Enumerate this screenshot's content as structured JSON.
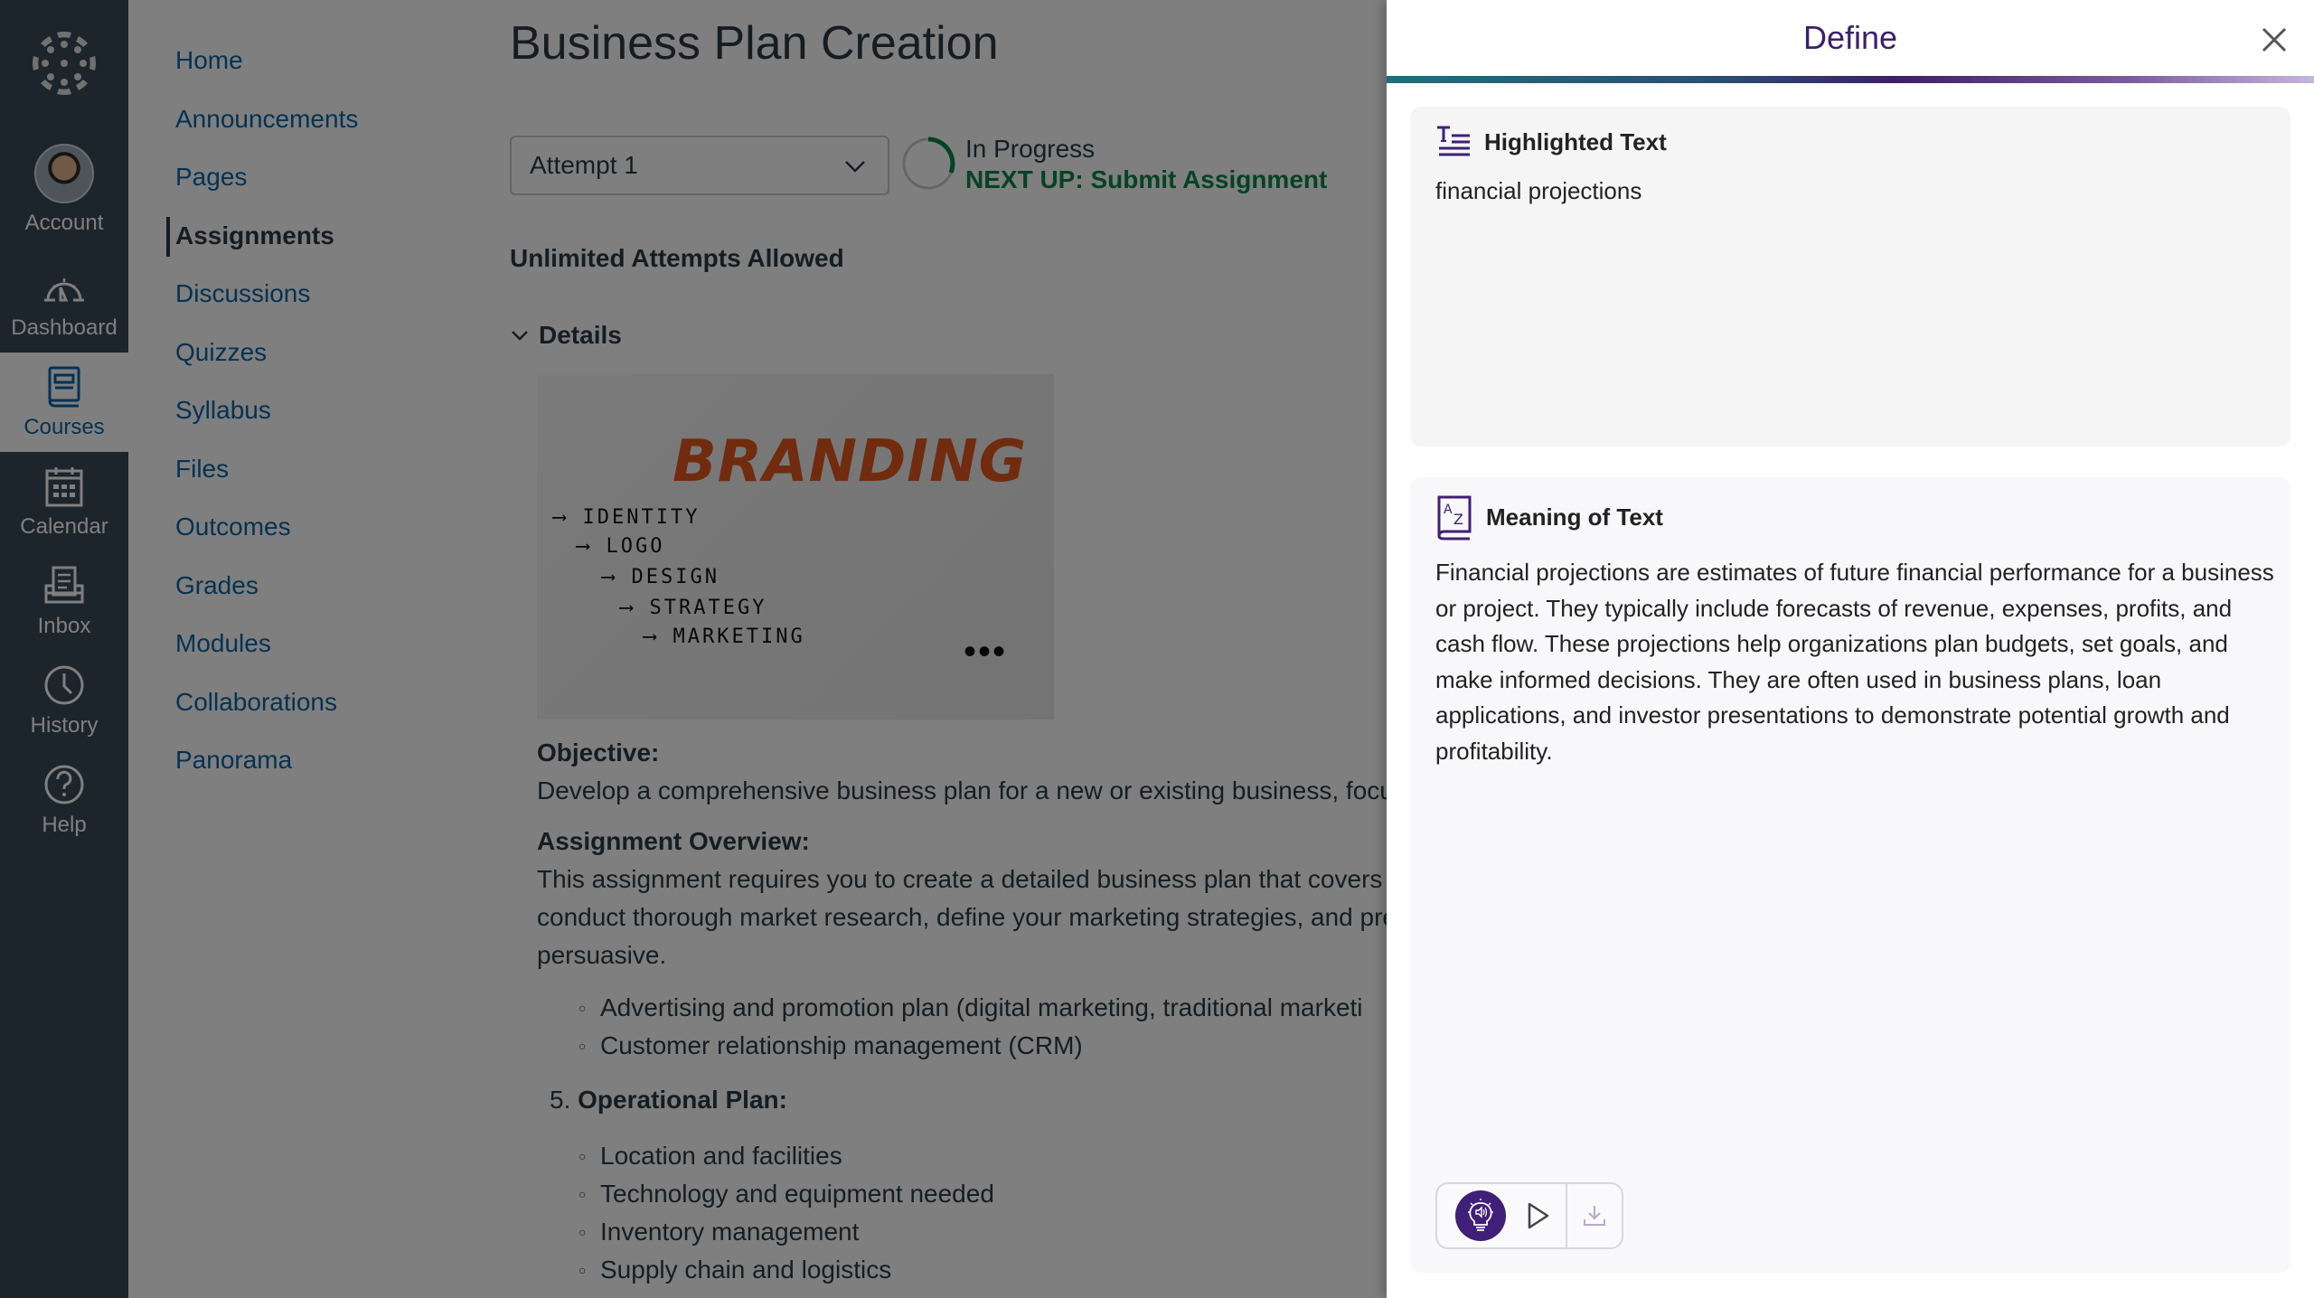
{
  "global_nav": {
    "items": [
      {
        "label": "Account",
        "icon": "avatar"
      },
      {
        "label": "Dashboard",
        "icon": "dashboard-icon"
      },
      {
        "label": "Courses",
        "icon": "courses-icon",
        "active": true
      },
      {
        "label": "Calendar",
        "icon": "calendar-icon"
      },
      {
        "label": "Inbox",
        "icon": "inbox-icon"
      },
      {
        "label": "History",
        "icon": "history-icon"
      },
      {
        "label": "Help",
        "icon": "help-icon"
      }
    ]
  },
  "course_nav": {
    "items": [
      {
        "label": "Home"
      },
      {
        "label": "Announcements"
      },
      {
        "label": "Pages"
      },
      {
        "label": "Assignments",
        "active": true
      },
      {
        "label": "Discussions"
      },
      {
        "label": "Quizzes"
      },
      {
        "label": "Syllabus"
      },
      {
        "label": "Files"
      },
      {
        "label": "Outcomes"
      },
      {
        "label": "Grades"
      },
      {
        "label": "Modules"
      },
      {
        "label": "Collaborations"
      },
      {
        "label": "Panorama"
      }
    ]
  },
  "main": {
    "title": "Business Plan Creation",
    "attempt_select": "Attempt 1",
    "status": "In Progress",
    "next_up": "NEXT UP: Submit Assignment",
    "attempts_allowed": "Unlimited Attempts Allowed",
    "details_label": "Details",
    "image": {
      "heading": "BRANDING",
      "items": [
        "IDENTITY",
        "LOGO",
        "DESIGN",
        "STRATEGY",
        "MARKETING"
      ],
      "ellipsis": "•••"
    },
    "objective_heading": "Objective:",
    "objective_text": "Develop a comprehensive business plan for a new or existing business, focus",
    "overview_heading": "Assignment Overview:",
    "overview_lines": [
      "This assignment requires you to create a detailed business plan that covers th",
      "conduct thorough market research, define your marketing strategies, and pre",
      "persuasive."
    ],
    "marketing_bullets": [
      "Advertising and promotion plan (digital marketing, traditional marketi",
      "Customer relationship management (CRM)"
    ],
    "section5_number": "5.",
    "section5_heading": "Operational Plan:",
    "operational_bullets": [
      "Location and facilities",
      "Technology and equipment needed",
      "Inventory management",
      "Supply chain and logistics"
    ]
  },
  "panel": {
    "title": "Define",
    "highlighted_heading": "Highlighted Text",
    "highlighted_text": "financial projections",
    "meaning_heading": "Meaning of Text",
    "meaning_text": "Financial projections are estimates of future financial performance for a business or project. They typically include forecasts of revenue, expenses, profits, and cash flow. These projections help organizations plan budgets, set goals, and make informed decisions. They are often used in business plans, loan applications, and investor presentations to demonstrate potential growth and profitability.",
    "accent_color": "#3f1f78"
  }
}
